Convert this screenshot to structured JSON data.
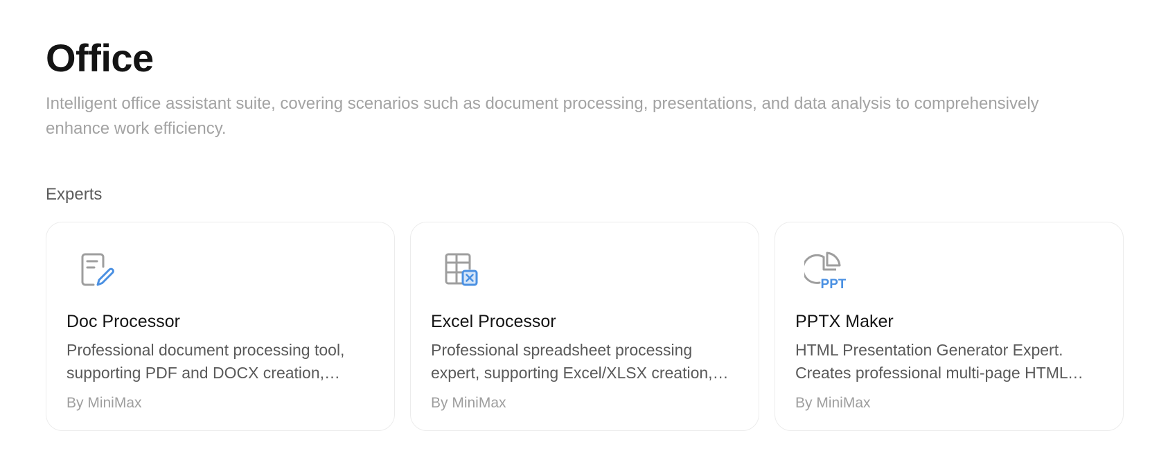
{
  "page": {
    "title": "Office",
    "description": "Intelligent office assistant suite, covering scenarios such as document processing, presentations, and data analysis to comprehensively enhance work efficiency."
  },
  "section": {
    "label": "Experts"
  },
  "colors": {
    "icon_gray": "#9e9e9e",
    "icon_blue": "#4a90e2"
  },
  "cards": [
    {
      "icon": "document-edit-icon",
      "title": "Doc Processor",
      "description": "Professional document processing tool, supporting PDF and DOCX creation, editing, and format conversion.",
      "author": "By MiniMax"
    },
    {
      "icon": "spreadsheet-excel-icon",
      "title": "Excel Processor",
      "description": "Professional spreadsheet processing expert, supporting Excel/XLSX creation, editing, and data analysis.",
      "author": "By MiniMax"
    },
    {
      "icon": "pie-chart-ppt-icon",
      "title": "PPTX Maker",
      "description": "HTML Presentation Generator Expert. Creates professional multi-page HTML presentations.",
      "author": "By MiniMax",
      "icon_text": "PPT"
    }
  ]
}
